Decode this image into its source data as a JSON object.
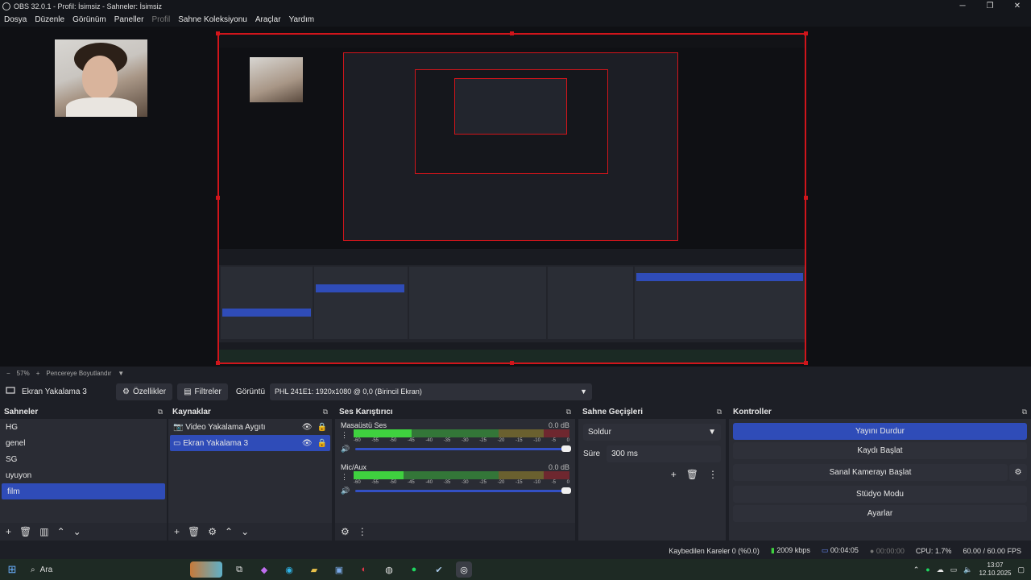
{
  "window": {
    "title": "OBS 32.0.1 - Profil: İsimsiz - Sahneler: İsimsiz",
    "min": "─",
    "max": "❐",
    "close": "✕"
  },
  "menu": [
    "Dosya",
    "Düzenle",
    "Görünüm",
    "Paneller",
    "Profil",
    "Sahne Koleksiyonu",
    "Araçlar",
    "Yardım"
  ],
  "zoom": {
    "minus": "−",
    "value": "57%",
    "plus": "+",
    "fit": "Pencereye Boyutlandır",
    "arrow": "▼"
  },
  "source_bar": {
    "source_name": "Ekran Yakalama 3",
    "properties": "Özellikler",
    "filters": "Filtreler",
    "display_label": "Görüntü",
    "display_value": "PHL 241E1: 1920x1080 @ 0,0 (Birincil Ekran)"
  },
  "scenes": {
    "title": "Sahneler",
    "items": [
      "HG",
      "genel",
      "SG",
      "uyuyon",
      "film"
    ],
    "selected": "film"
  },
  "sources": {
    "title": "Kaynaklar",
    "items": [
      "Video Yakalama Aygıtı",
      "Ekran Yakalama 3"
    ],
    "selected": "Ekran Yakalama 3"
  },
  "mixer": {
    "title": "Ses Karıştırıcı",
    "tracks": [
      {
        "name": "Masaüstü Ses",
        "db": "0.0 dB",
        "level": 0.27
      },
      {
        "name": "Mic/Aux",
        "db": "0.0 dB",
        "level": 0.23
      }
    ],
    "ticks": [
      "-60",
      "-55",
      "-50",
      "-45",
      "-40",
      "-35",
      "-30",
      "-25",
      "-20",
      "-15",
      "-10",
      "-5",
      "0"
    ]
  },
  "transitions": {
    "title": "Sahne Geçişleri",
    "type": "Soldur",
    "duration_label": "Süre",
    "duration_value": "300 ms"
  },
  "controls": {
    "title": "Kontroller",
    "stop_stream": "Yayını Durdur",
    "start_record": "Kaydı Başlat",
    "virtual_cam": "Sanal Kamerayı Başlat",
    "studio_mode": "Stüdyo Modu",
    "settings": "Ayarlar"
  },
  "status": {
    "dropped": "Kaybedilen Kareler 0 (%0.0)",
    "bitrate": "2009 kbps",
    "stream_time": "00:04:05",
    "record_time": "00:00:00",
    "cpu": "CPU: 1.7%",
    "fps": "60.00 / 60.00 FPS"
  },
  "taskbar": {
    "search": "Ara",
    "time": "13:07",
    "date": "12.10.2025"
  },
  "colors": {
    "accent": "#2f4cb8",
    "selection_border": "#d0151b",
    "meter_green": "#3fd13f",
    "meter_yellow": "#b8a02a",
    "meter_red": "#c0222a"
  }
}
